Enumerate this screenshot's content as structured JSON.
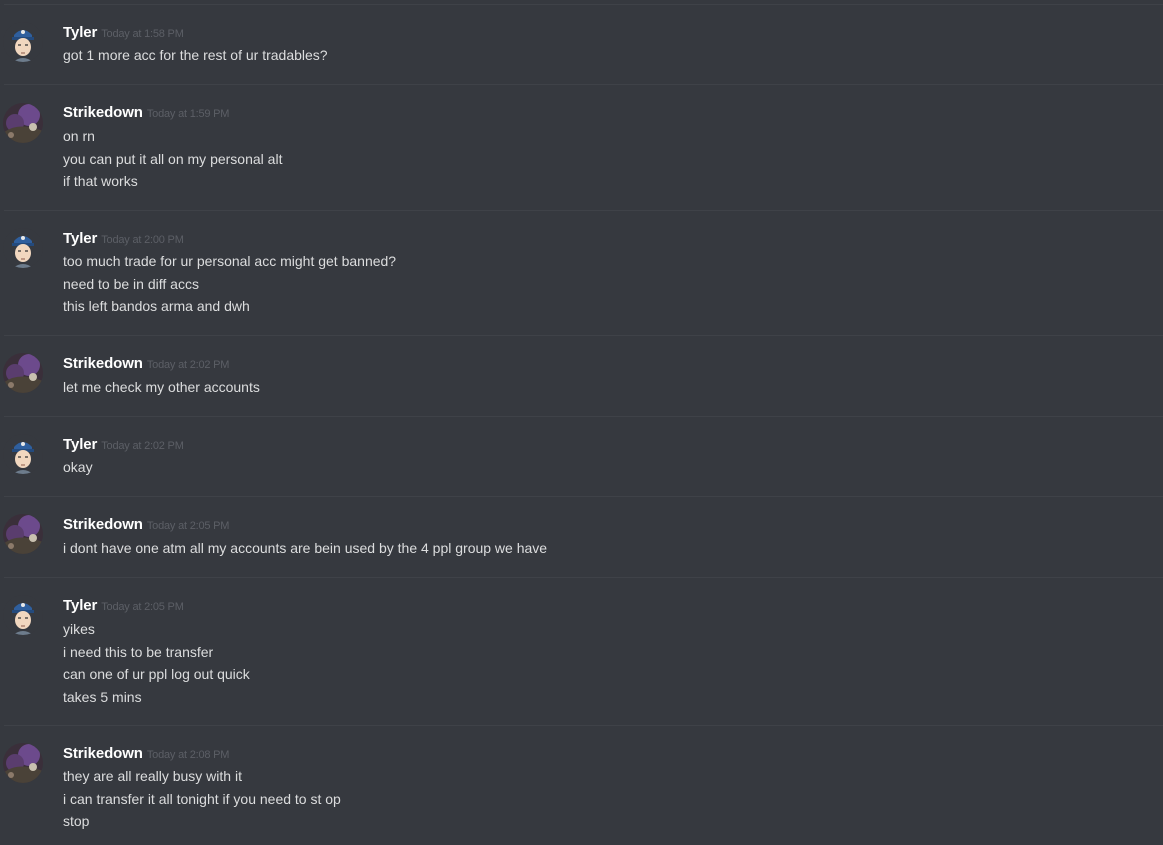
{
  "messages": [
    {
      "author": "Tyler",
      "timestamp": "Today at 1:58 PM",
      "lines": [
        "got 1 more acc for the rest of ur tradables?"
      ]
    },
    {
      "author": "Strikedown",
      "timestamp": "Today at 1:59 PM",
      "lines": [
        "on rn",
        "you can put it all on my personal alt",
        "if that works"
      ]
    },
    {
      "author": "Tyler",
      "timestamp": "Today at 2:00 PM",
      "lines": [
        "too much trade for ur personal acc might get banned?",
        "need to be in diff accs",
        "this left bandos arma and dwh"
      ]
    },
    {
      "author": "Strikedown",
      "timestamp": "Today at 2:02 PM",
      "lines": [
        "let me check my other accounts"
      ]
    },
    {
      "author": "Tyler",
      "timestamp": "Today at 2:02 PM",
      "lines": [
        "okay"
      ]
    },
    {
      "author": "Strikedown",
      "timestamp": "Today at 2:05 PM",
      "lines": [
        "i dont have one atm all my accounts are bein used by the 4 ppl group we have"
      ]
    },
    {
      "author": "Tyler",
      "timestamp": "Today at 2:05 PM",
      "lines": [
        "yikes",
        "i need this to be transfer",
        "can one of ur ppl log out quick",
        "takes 5 mins"
      ]
    },
    {
      "author": "Strikedown",
      "timestamp": "Today at 2:08 PM",
      "lines": [
        "they are all really busy with it",
        "i can transfer it all tonight if you need to st op",
        "stop"
      ]
    }
  ],
  "theme": {
    "background": "#36393f",
    "divider": "#3f4248",
    "username_color": "#ffffff",
    "timestamp_color": "#5c5f66",
    "text_color": "#dcddde"
  },
  "avatars": {
    "Tyler": "cartoon-character-avatar",
    "Strikedown": "purple-scenery-avatar"
  }
}
